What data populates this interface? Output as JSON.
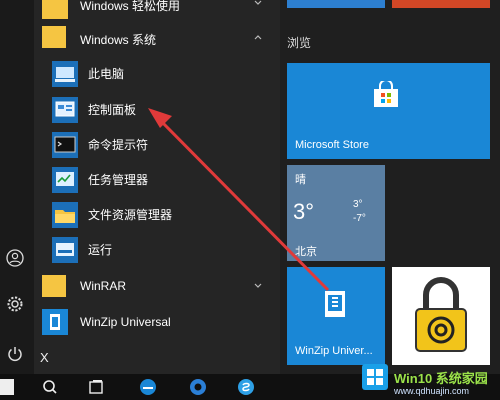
{
  "app_list": {
    "top_cut_label": "Windows 轻松使用",
    "windows_system_label": "Windows 系统",
    "items": [
      {
        "label": "此电脑",
        "icon": "this-pc-icon"
      },
      {
        "label": "控制面板",
        "icon": "control-panel-icon"
      },
      {
        "label": "命令提示符",
        "icon": "command-prompt-icon"
      },
      {
        "label": "任务管理器",
        "icon": "task-manager-icon"
      },
      {
        "label": "文件资源管理器",
        "icon": "file-explorer-icon"
      },
      {
        "label": "运行",
        "icon": "run-icon"
      }
    ],
    "winrar_label": "WinRAR",
    "winzip_label": "WinZip Universal",
    "x_header": "X"
  },
  "tiles": {
    "section_title": "浏览",
    "store_label": "Microsoft Store",
    "weather": {
      "condition": "晴",
      "temp": "3°",
      "high": "3°",
      "low": "-7°",
      "city": "北京"
    },
    "winzip_tile_label": "WinZip Univer..."
  },
  "watermark": {
    "brand": "Win10 系统家园",
    "url": "www.qdhuajin.com"
  },
  "colors": {
    "accent": "#0078d7",
    "tile_blue": "#1a87d6",
    "folder_yellow": "#f5c542",
    "arrow_red": "#e03a3a"
  }
}
